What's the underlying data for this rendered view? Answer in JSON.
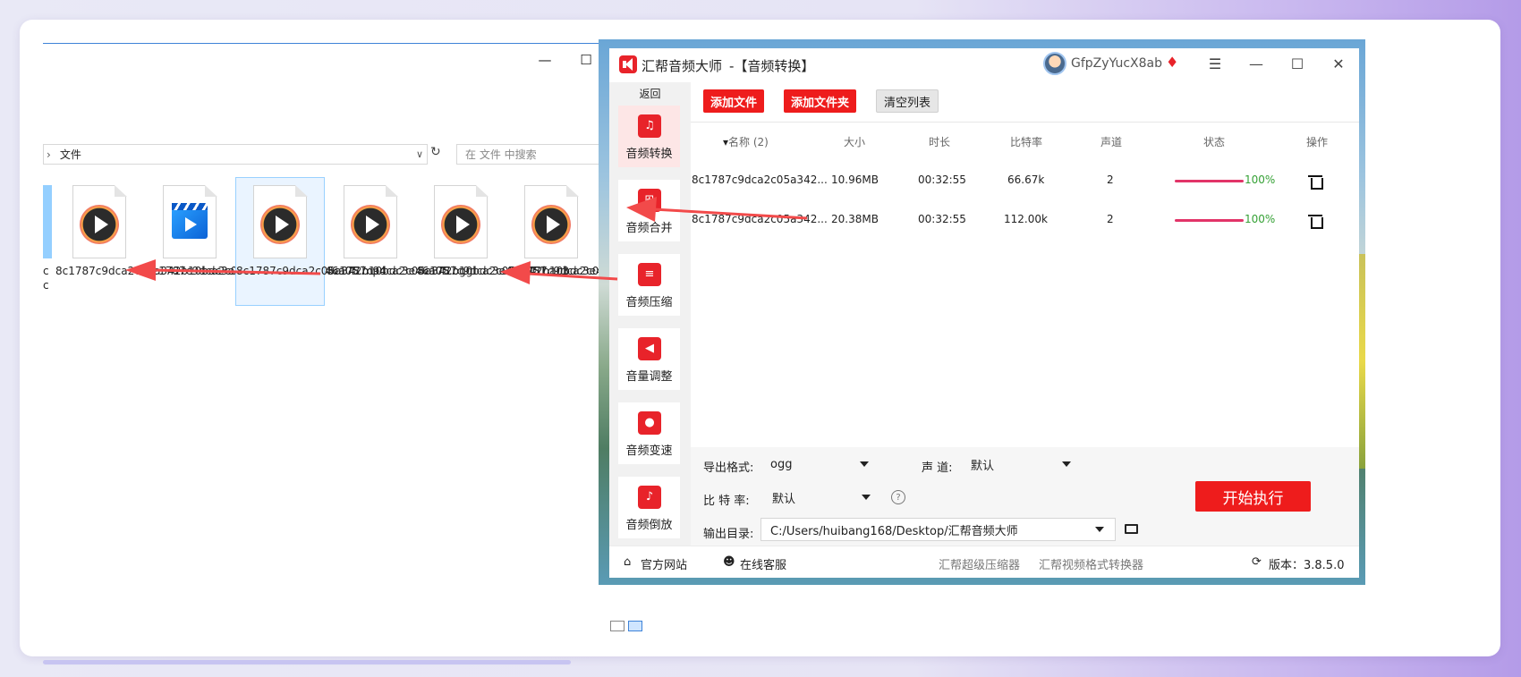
{
  "explorer": {
    "address_parts": [
      "文件"
    ],
    "search_placeholder": "在 文件 中搜索",
    "partial_item_name": "c\nc",
    "files": [
      {
        "name": "8c1787c9dca2c05a342b10bdc3e46a05.mp3",
        "type": "audio",
        "selected": false
      },
      {
        "name": "8c1787c9dca2c05a342b10bdc3e46a05.mp4",
        "type": "video",
        "selected": false
      },
      {
        "name": "8c1787c9dca2c05a342b10bdc3e46a05.ogg",
        "type": "audio",
        "selected": true
      },
      {
        "name": "8c1787c9dca2c05a342b10bdc3e46a051.ac3",
        "type": "audio",
        "selected": false
      },
      {
        "name": "8c1787c9dca2c05a342b10bdc3e46a051.mp3",
        "type": "audio",
        "selected": false
      },
      {
        "name": "8c1787c9dca2c05a342b10bdc3e46a051.ogg",
        "type": "audio",
        "selected": false
      }
    ]
  },
  "app": {
    "title": "汇帮音频大师",
    "subtitle": "-【音频转换】",
    "username": "GfpZyYucX8ab",
    "back_label": "返回",
    "nav": [
      {
        "label": "音频转换",
        "icon": "audio-convert-icon",
        "active": true
      },
      {
        "label": "音频合并",
        "icon": "audio-merge-icon",
        "active": false
      },
      {
        "label": "音频压缩",
        "icon": "audio-compress-icon",
        "active": false
      },
      {
        "label": "音量调整",
        "icon": "volume-icon",
        "active": false
      },
      {
        "label": "音频变速",
        "icon": "mic-icon",
        "active": false
      },
      {
        "label": "音频倒放",
        "icon": "music-note-icon",
        "active": false
      }
    ],
    "toolbar": {
      "add_file": "添加文件",
      "add_folder": "添加文件夹",
      "clear_list": "清空列表"
    },
    "table": {
      "headers": [
        "名称 (2)",
        "大小",
        "时长",
        "比特率",
        "声道",
        "状态",
        "操作"
      ],
      "rows": [
        {
          "name": "8c1787c9dca2c05a342...",
          "size": "10.96MB",
          "duration": "00:32:55",
          "bitrate": "66.67k",
          "channels": "2",
          "progress": 1.0,
          "progress_text": "100%"
        },
        {
          "name": "8c1787c9dca2c05a342...",
          "size": "20.38MB",
          "duration": "00:32:55",
          "bitrate": "112.00k",
          "channels": "2",
          "progress": 1.0,
          "progress_text": "100%"
        }
      ]
    },
    "options": {
      "format_label": "导出格式:",
      "format_value": "ogg",
      "channel_label": "声 道:",
      "channel_value": "默认",
      "bitrate_label": "比 特 率:",
      "bitrate_value": "默认",
      "output_label": "输出目录:",
      "output_value": "C:/Users/huibang168/Desktop/汇帮音频大师"
    },
    "start_button": "开始执行",
    "footer": {
      "official_site": "官方网站",
      "online_service": "在线客服",
      "link1": "汇帮超级压缩器",
      "link2": "汇帮视频格式转换器",
      "version": "版本：3.8.5.0"
    },
    "colors": {
      "accent": "#ee1c1c",
      "progress": "#e23468",
      "success": "#35a135"
    }
  }
}
